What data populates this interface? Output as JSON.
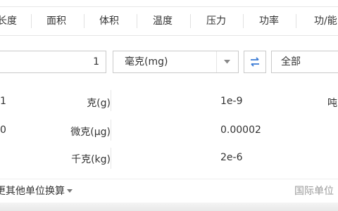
{
  "tabs": [
    {
      "label": "长度"
    },
    {
      "label": "面积"
    },
    {
      "label": "体积"
    },
    {
      "label": "温度"
    },
    {
      "label": "压力"
    },
    {
      "label": "功率"
    },
    {
      "label": "功/能"
    }
  ],
  "input": {
    "value": "1",
    "from_unit": "毫克(mg)",
    "scope": "全部"
  },
  "results": {
    "left": [
      {
        "value": "1",
        "unit": "克(g)"
      },
      {
        "value": "0",
        "unit": "微克(μg)"
      },
      {
        "value": "",
        "unit": "千克(kg)"
      }
    ],
    "right": [
      {
        "value": "1e-9",
        "unit": "吨"
      },
      {
        "value": "0.00002",
        "unit": ""
      },
      {
        "value": "2e-6",
        "unit": ""
      }
    ]
  },
  "footer": {
    "more_conversions": "更其他单位换算",
    "international_units": "国际单位"
  },
  "colors": {
    "swap_icon": "#3a7bd5",
    "border": "#c9c9c9",
    "divider": "#e6e6e6",
    "muted_text": "#9a9a9a"
  },
  "icons": [
    "chevron-down-icon",
    "swap-icon",
    "caret-down-icon"
  ]
}
